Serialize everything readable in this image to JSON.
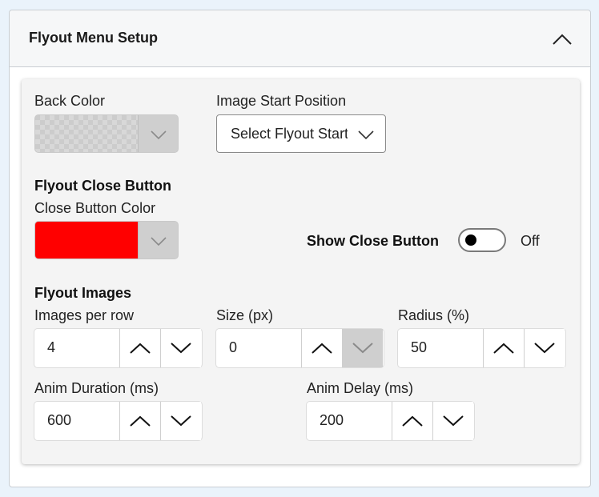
{
  "panel": {
    "title": "Flyout Menu Setup"
  },
  "back_color": {
    "label": "Back Color"
  },
  "image_start": {
    "label": "Image Start Position",
    "selected": "Select Flyout Start Position"
  },
  "close_button": {
    "heading": "Flyout Close Button",
    "color_label": "Close Button Color",
    "color_value": "#ff0000",
    "show_label": "Show Close Button",
    "toggle_state": "Off"
  },
  "images": {
    "heading": "Flyout Images",
    "per_row": {
      "label": "Images per row",
      "value": "4"
    },
    "size": {
      "label": "Size (px)",
      "value": "0"
    },
    "radius": {
      "label": "Radius (%)",
      "value": "50"
    },
    "anim_duration": {
      "label": "Anim Duration (ms)",
      "value": "600"
    },
    "anim_delay": {
      "label": "Anim Delay (ms)",
      "value": "200"
    }
  },
  "icons": {
    "collapse": "chevron-up-icon",
    "dropdown": "chevron-down-icon",
    "increment": "chevron-up-icon",
    "decrement": "chevron-down-icon"
  },
  "colors": {
    "page_background": "#eaf3fb",
    "inner_background": "#f4f4f4",
    "close_button_color": "#ff0000"
  }
}
